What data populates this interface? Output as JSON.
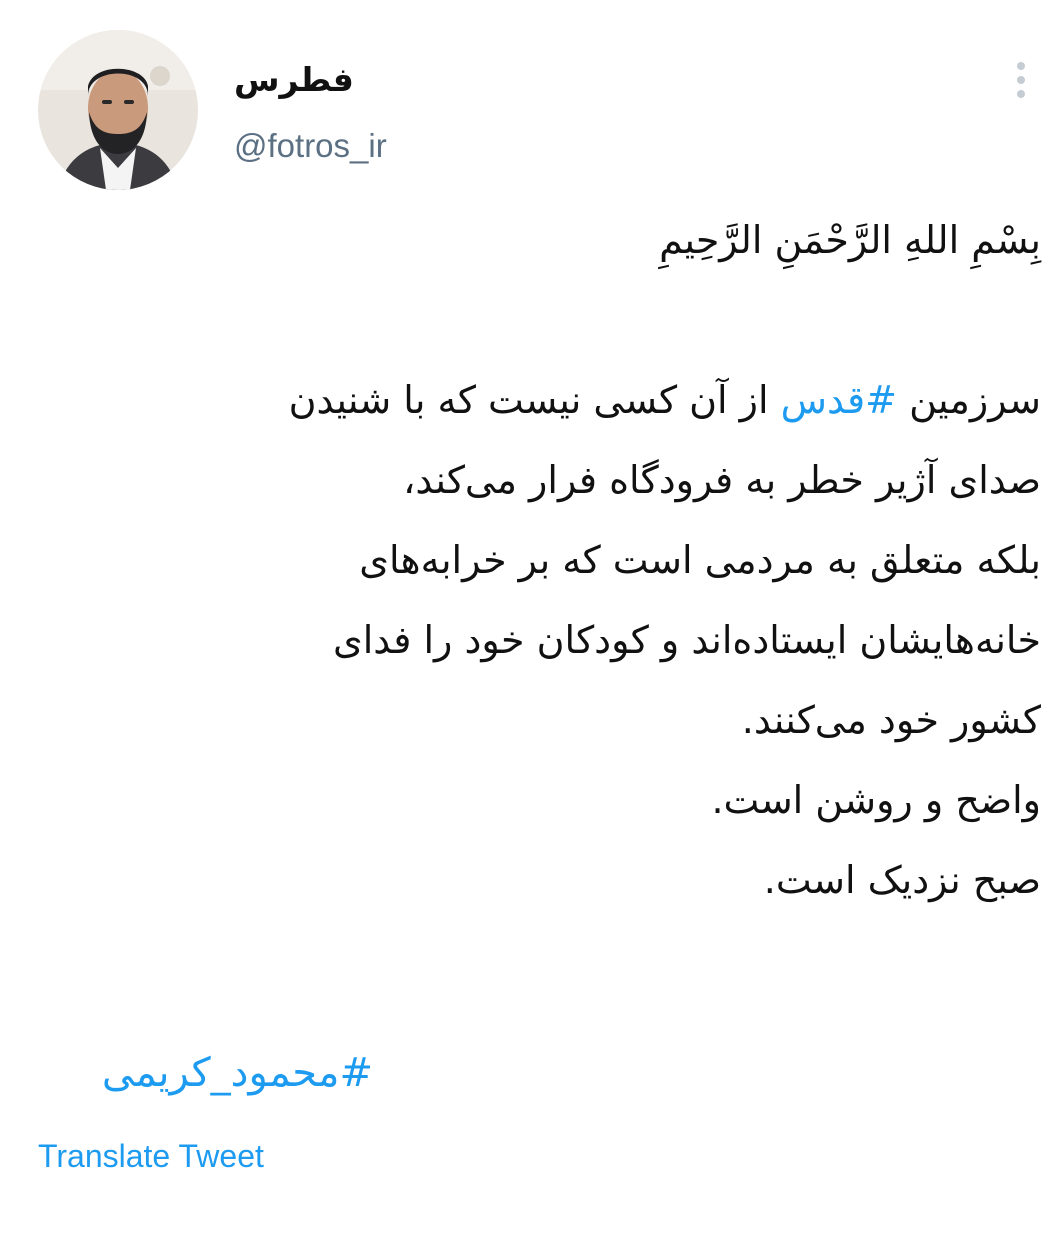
{
  "author": {
    "display_name": "فطرس",
    "handle": "@fotros_ir",
    "avatar_icon": "user-avatar"
  },
  "menu": {
    "icon": "more-vertical-icon"
  },
  "tweet": {
    "bismillah": "بِسْمِ اللهِ الرَّحْمَنِ الرَّحِيمِ",
    "line1_before": "سرزمین ",
    "line1_hashtag": "#قدس",
    "line1_after": " از آن کسی نیست که با شنیدن",
    "line2": "صدای آژیر خطر به فرودگاه فرار می‌کند،",
    "line3": "بلکه متعلق به مردمی است که بر خرابه‌های",
    "line4": "خانه‌هایشان ایستاده‌اند و کودکان خود را فدای",
    "line5": "کشور خود می‌کنند.",
    "line6": "واضح و روشن است.",
    "line7": "صبح نزدیک است.",
    "closing_hashtag": "#محمود_کریمی"
  },
  "actions": {
    "translate_label": "Translate Tweet"
  },
  "colors": {
    "link": "#1d9bf0",
    "handle": "#5b7083",
    "text": "#111111",
    "menu_dots": "#c5ccd3"
  }
}
